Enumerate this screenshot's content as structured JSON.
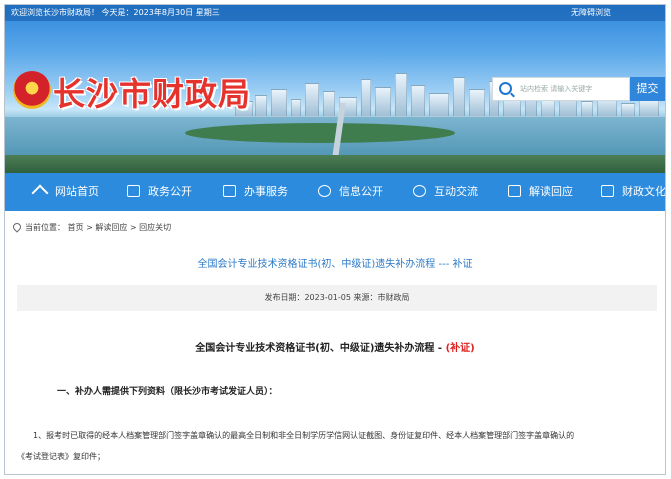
{
  "topbar": {
    "welcome": "欢迎浏览长沙市财政局！ 今天是：2023年8月30日 星期三",
    "barrier_free": "无障碍浏览"
  },
  "header": {
    "logo_text": "长沙市财政局",
    "search_placeholder": "站内检索   请输入关键字",
    "submit_label": "提交"
  },
  "nav": {
    "items": [
      {
        "label": "网站首页",
        "icon": "home-icon"
      },
      {
        "label": "政务公开",
        "icon": "monitor-icon"
      },
      {
        "label": "办事服务",
        "icon": "document-icon"
      },
      {
        "label": "信息公开",
        "icon": "info-icon"
      },
      {
        "label": "互动交流",
        "icon": "chat-icon"
      },
      {
        "label": "解读回应",
        "icon": "book-icon"
      },
      {
        "label": "财政文化",
        "icon": "file-icon"
      }
    ]
  },
  "breadcrumb": {
    "prefix": "当前位置：",
    "home": "首页",
    "level1": "解读回应",
    "level2": "回应关切",
    "sep": ">"
  },
  "article": {
    "link_title": "全国会计专业技术资格证书(初、中级证)遗失补办流程 --- 补证",
    "publish_label": "发布日期：2023-01-05 来源：市财政局",
    "heading_main": "全国会计专业技术资格证书(初、中级证)遗失补办流程 - ",
    "heading_red": "(补证)",
    "section1": "一、补办人需提供下列资料（限长沙市考试发证人员）：",
    "para1_line1": "1、报考时已取得的经本人档案管理部门签字盖章确认的最高全日制和非全日制学历学信网认证截图、身份证复印件、经本人档案管理部门签字盖章确认的",
    "para1_line2": "《考试登记表》复印件；"
  },
  "colors": {
    "nav_bg": "#2c8bdc",
    "logo_red": "#e6322c",
    "link_blue": "#2a79c8",
    "heading_red": "#e02020"
  }
}
